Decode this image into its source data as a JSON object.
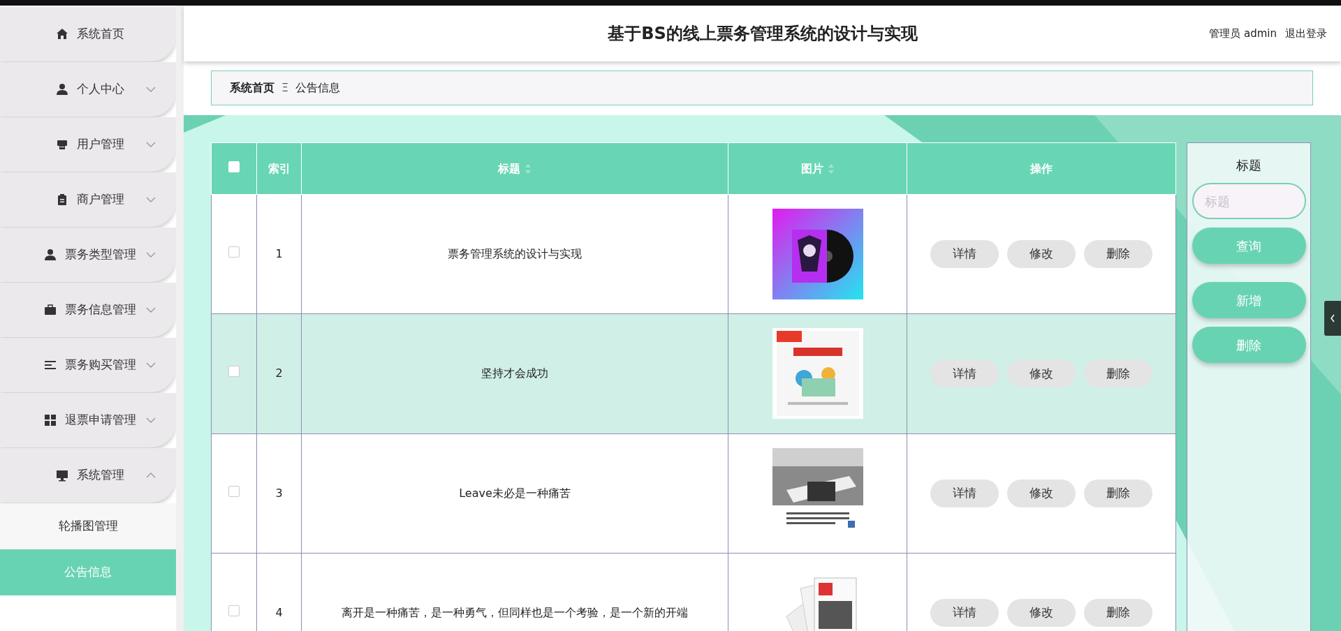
{
  "sidebar": {
    "items": [
      {
        "label": "系统首页",
        "kind": "link"
      },
      {
        "label": "个人中心",
        "kind": "submenu",
        "expanded": false
      },
      {
        "label": "用户管理",
        "kind": "submenu",
        "expanded": false
      },
      {
        "label": "商户管理",
        "kind": "submenu",
        "expanded": false
      },
      {
        "label": "票务类型管理",
        "kind": "submenu",
        "expanded": false
      },
      {
        "label": "票务信息管理",
        "kind": "submenu",
        "expanded": false
      },
      {
        "label": "票务购买管理",
        "kind": "submenu",
        "expanded": false
      },
      {
        "label": "退票申请管理",
        "kind": "submenu",
        "expanded": false
      },
      {
        "label": "系统管理",
        "kind": "submenu",
        "expanded": true,
        "children": [
          {
            "label": "轮播图管理",
            "selected": false
          },
          {
            "label": "公告信息",
            "selected": true
          }
        ]
      }
    ]
  },
  "header": {
    "title": "基于BS的线上票务管理系统的设计与实现",
    "user": "管理员 admin",
    "logout": "退出登录"
  },
  "breadcrumb": {
    "items": [
      "系统首页",
      "公告信息"
    ],
    "separator": "Ξ"
  },
  "table": {
    "header_checkbox": {
      "checked": false
    },
    "columns": [
      {
        "label": "索引",
        "sortable": false
      },
      {
        "label": "标题",
        "sortable": true
      },
      {
        "label": "图片",
        "sortable": true
      },
      {
        "label": "操作",
        "sortable": false
      }
    ],
    "rows": [
      {
        "checked": false,
        "selected": false,
        "index": "1",
        "title": "票务管理系统的设计与实现",
        "picture": {
          "kind": "picture"
        },
        "actions": [
          "详情",
          "修改",
          "删除"
        ]
      },
      {
        "checked": false,
        "selected": true,
        "index": "2",
        "title": "坚持才会成功",
        "picture": {
          "kind": "picture"
        },
        "actions": [
          "详情",
          "修改",
          "删除"
        ]
      },
      {
        "checked": false,
        "selected": false,
        "index": "3",
        "title": "Leave未必是一种痛苦",
        "picture": {
          "kind": "picture"
        },
        "actions": [
          "详情",
          "修改",
          "删除"
        ]
      },
      {
        "checked": false,
        "selected": false,
        "index": "4",
        "title": "离开是一种痛苦，是一种勇气，但同样也是一个考验，是一个新的开端",
        "picture": {
          "kind": "picture"
        },
        "actions": [
          "详情",
          "修改",
          "删除"
        ]
      }
    ]
  },
  "search_panel": {
    "label": "标题",
    "placeholder": "标题",
    "buttons": [
      "查询",
      "新增",
      "删除"
    ]
  }
}
